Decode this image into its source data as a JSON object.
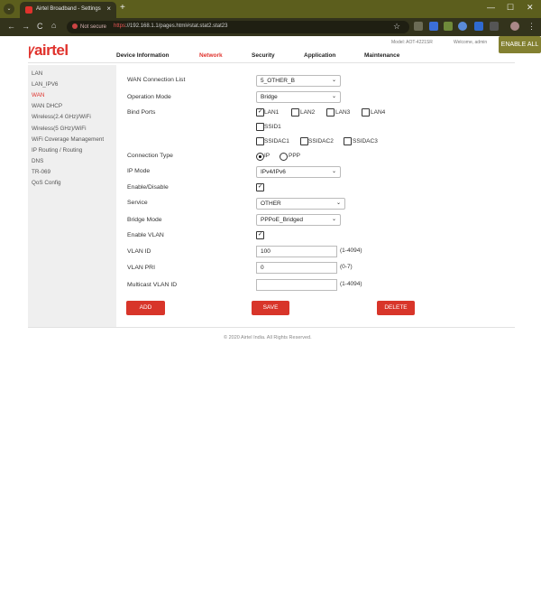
{
  "browser": {
    "tab_title": "Airtel Broadband - Settings",
    "tab_close": "×",
    "new_tab": "+",
    "tab_menu": "⌄",
    "win_min": "—",
    "win_max": "☐",
    "win_close": "✕",
    "security": "Not secure",
    "url_scheme": "https",
    "url_rest": "://192.168.1.1/pages.html#stat.stat2.stat23",
    "back": "←",
    "forward": "→",
    "reload": "C",
    "home": "⌂",
    "star": "☆",
    "menu": "⋮",
    "accent": "#5c5e1d"
  },
  "header": {
    "logo_text": "airtel",
    "model": "Model: AOT-4221SR",
    "welcome": "Welcome, admin",
    "enable_all": "ENABLE ALL",
    "brand_color": "#e0322c"
  },
  "nav": {
    "items": [
      "Device Information",
      "Network",
      "Security",
      "Application",
      "Maintenance"
    ],
    "active": "Network"
  },
  "sidebar": {
    "items": [
      "LAN",
      "LAN_IPV6",
      "WAN",
      "WAN DHCP",
      "Wireless(2.4 GHz)/WiFi",
      "Wireless(5 GHz)/WiFi",
      "WiFi Coverage Management",
      "IP Routing / Routing",
      "DNS",
      "TR-069",
      "QoS Config"
    ],
    "active": "WAN"
  },
  "form": {
    "wan_connection_list": {
      "label": "WAN Connection List",
      "value": "5_OTHER_B"
    },
    "operation_mode": {
      "label": "Operation Mode",
      "value": "Bridge"
    },
    "bind_ports": {
      "label": "Bind Ports",
      "ports": [
        {
          "name": "LAN1",
          "checked": "✓"
        },
        {
          "name": "LAN2",
          "checked": ""
        },
        {
          "name": "LAN3",
          "checked": ""
        },
        {
          "name": "LAN4",
          "checked": ""
        },
        {
          "name": "SSID1",
          "checked": ""
        },
        {
          "name": "SSIDAC1",
          "checked": ""
        },
        {
          "name": "SSIDAC2",
          "checked": ""
        },
        {
          "name": "SSIDAC3",
          "checked": ""
        }
      ]
    },
    "connection_type": {
      "label": "Connection Type",
      "options": [
        "IP",
        "PPP"
      ],
      "selected": "IP"
    },
    "ip_mode": {
      "label": "IP Mode",
      "value": "IPv4/IPv6"
    },
    "enable_disable": {
      "label": "Enable/Disable",
      "checked": "✓"
    },
    "service": {
      "label": "Service",
      "value": "OTHER"
    },
    "bridge_mode": {
      "label": "Bridge Mode",
      "value": "PPPoE_Bridged"
    },
    "enable_vlan": {
      "label": "Enable VLAN",
      "checked": "✓"
    },
    "vlan_id": {
      "label": "VLAN ID",
      "value": "100",
      "hint": "(1-4094)"
    },
    "vlan_pri": {
      "label": "VLAN PRI",
      "value": "0",
      "hint": "(0-7)"
    },
    "multicast_vlan_id": {
      "label": "Multicast VLAN ID",
      "value": "",
      "hint": "(1-4094)"
    }
  },
  "buttons": {
    "add": "ADD",
    "save": "SAVE",
    "delete": "DELETE"
  },
  "footer": "© 2020 Airtel India. All Rights Reserved.",
  "chevron": "⌄"
}
